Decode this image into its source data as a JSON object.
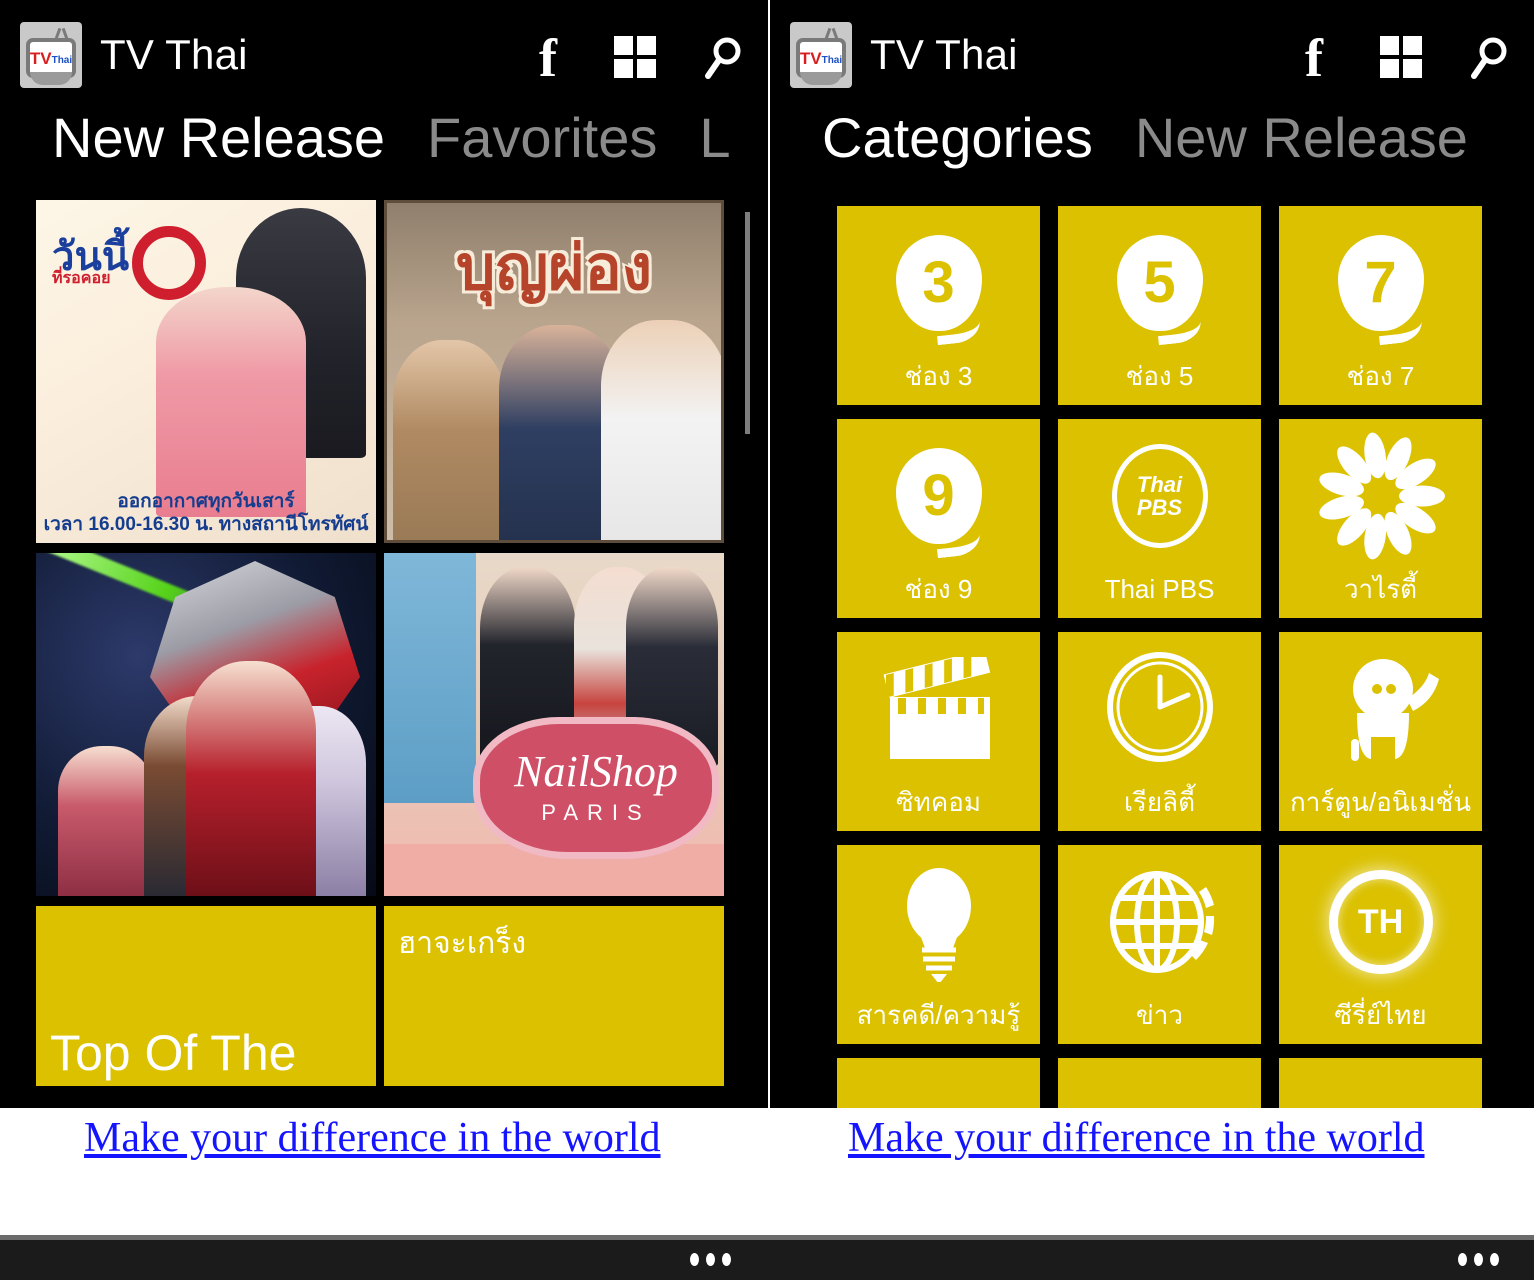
{
  "app": {
    "title_left": "TV Thai",
    "title_right": "TV Thai",
    "icon_tv": "TV",
    "icon_thai": "Thai"
  },
  "header_icons": {
    "facebook": "f",
    "tiles": "grid-tiles",
    "search": "search"
  },
  "left_panel": {
    "tabs": [
      {
        "label": "New Release",
        "active": true
      },
      {
        "label": "Favorites",
        "active": false
      },
      {
        "label": "L",
        "active": false
      }
    ],
    "tiles": [
      {
        "name": "wanni-show",
        "type": "poster",
        "title_th": "วันนี้",
        "subtitle_th": "ที่รอคอย",
        "caption_line1": "ออกอากาศทุกวันเสาร์",
        "caption_line2": "เวลา 16.00-16.30 น. ทางสถานีโทรทัศน์"
      },
      {
        "name": "boon-phong",
        "type": "poster",
        "title_th": "บุญผ่อง"
      },
      {
        "name": "anime-mecha",
        "type": "poster",
        "title_th": ""
      },
      {
        "name": "nail-shop-paris",
        "type": "poster",
        "title_en_1": "NailShop",
        "title_en_2": "PARIS"
      },
      {
        "name": "top-of-the",
        "type": "text-tile",
        "label": "Top Of The",
        "position": "bottom"
      },
      {
        "name": "ha-ja-kreng",
        "type": "text-tile",
        "label": "ฮาจะเกร็ง",
        "position": "top"
      }
    ]
  },
  "right_panel": {
    "tabs": [
      {
        "label": "Categories",
        "active": true
      },
      {
        "label": "New Release",
        "active": false
      }
    ],
    "categories": [
      {
        "label": "ช่อง 3",
        "icon": "channel-3-blob",
        "glyph": "3"
      },
      {
        "label": "ช่อง 5",
        "icon": "channel-5-blob",
        "glyph": "5"
      },
      {
        "label": "ช่อง 7",
        "icon": "channel-7-blob",
        "glyph": "7"
      },
      {
        "label": "ช่อง 9",
        "icon": "channel-9-blob",
        "glyph": "9"
      },
      {
        "label": "Thai PBS",
        "icon": "thai-pbs-ring",
        "glyph": "Thai PBS"
      },
      {
        "label": "วาไรตี้",
        "icon": "flower-petals",
        "glyph": ""
      },
      {
        "label": "ซิทคอม",
        "icon": "clapperboard-icon",
        "glyph": ""
      },
      {
        "label": "เรียลิตี้",
        "icon": "clock-icon",
        "glyph": ""
      },
      {
        "label": "การ์ตูน/อนิเมชั่น",
        "icon": "cartoon-character-icon",
        "glyph": ""
      },
      {
        "label": "สารคดี/ความรู้",
        "icon": "lightbulb-icon",
        "glyph": ""
      },
      {
        "label": "ข่าว",
        "icon": "globe-icon",
        "glyph": ""
      },
      {
        "label": "ซีรี่ย์ไทย",
        "icon": "th-ring-icon",
        "glyph": "TH"
      }
    ]
  },
  "ads": {
    "left_text": "Make your difference in the world ",
    "right_text": "Make your difference in the world "
  },
  "system_bar": {
    "overflow": "•••"
  },
  "colors": {
    "tile_yellow": "#DBC100",
    "background": "#000000",
    "active_tab": "#FFFFFF",
    "inactive_tab": "#8A8A8A",
    "link_blue": "#1414FF"
  }
}
